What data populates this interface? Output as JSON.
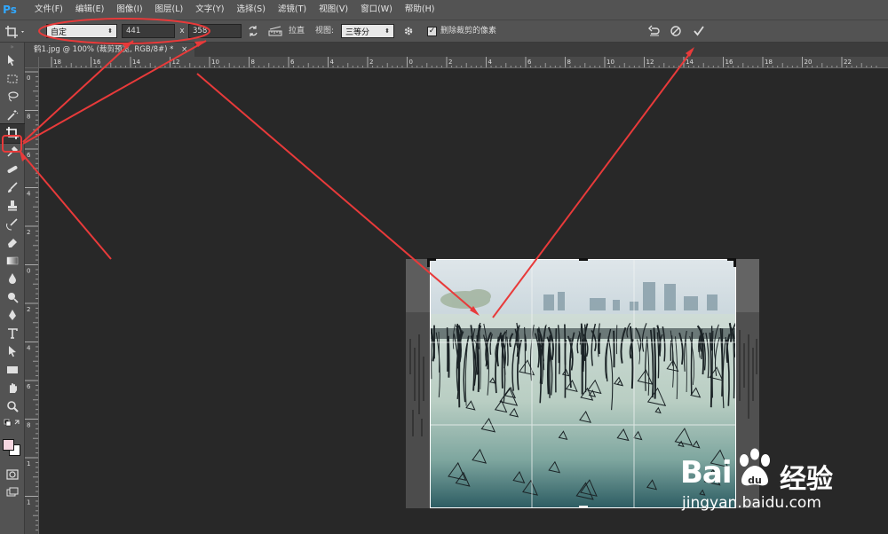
{
  "app": {
    "logo": "Ps"
  },
  "menu": [
    "文件(F)",
    "编辑(E)",
    "图像(I)",
    "图层(L)",
    "文字(Y)",
    "选择(S)",
    "滤镜(T)",
    "视图(V)",
    "窗口(W)",
    "帮助(H)"
  ],
  "options": {
    "ratio_select": "自定",
    "width_value": "441",
    "times": "x",
    "height_value": "358",
    "straighten_label": "拉直",
    "view_label": "视图:",
    "view_select": "三等分",
    "delete_pixels_checked": true,
    "delete_pixels_label": "删除裁剪的像素"
  },
  "document": {
    "tab_title": "鹤1.jpg @ 100% (裁剪预览, RGB/8#) *",
    "tab_close": "×"
  },
  "rulers": {
    "horizontal_labels": [
      "18",
      "16",
      "14",
      "12",
      "10",
      "8",
      "6",
      "4",
      "2",
      "0",
      "2",
      "4",
      "6",
      "8",
      "10",
      "12",
      "14",
      "16",
      "18",
      "20",
      "22"
    ],
    "vertical_labels": [
      "0",
      "8",
      "6",
      "4",
      "2",
      "0",
      "2",
      "4",
      "6",
      "8",
      "1",
      "1",
      "2"
    ]
  },
  "watermark": {
    "brand": "Bai",
    "brand2": "du",
    "service": "经验",
    "url": "jingyan.baidu.com"
  },
  "colors": {
    "ui_bg": "#535353",
    "canvas_bg": "#282828",
    "annotation_red": "#e83a3a",
    "foreground_swatch": "#f5d6e0",
    "background_swatch": "#ffffff"
  }
}
